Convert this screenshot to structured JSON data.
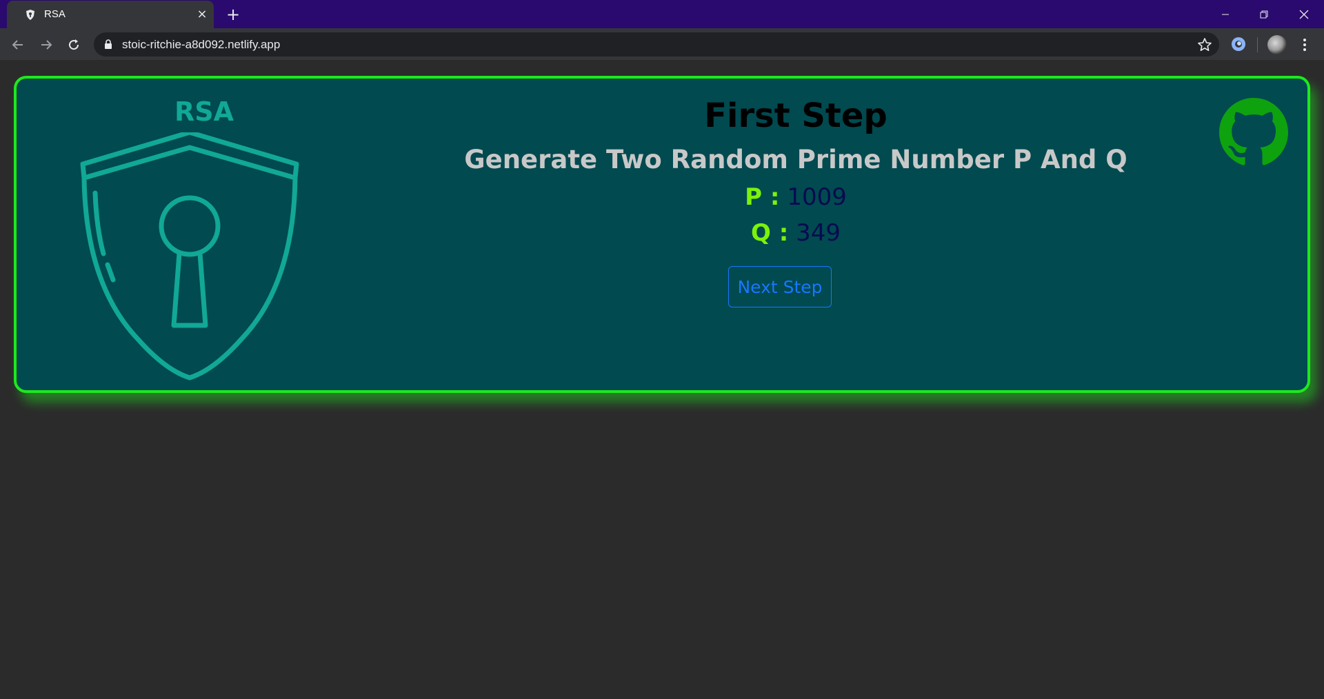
{
  "browser": {
    "tab_title": "RSA",
    "tab_close": "×",
    "new_tab": "+",
    "url": "stoic-ritchie-a8d092.netlify.app"
  },
  "page": {
    "logo_title": "RSA",
    "step_title": "First Step",
    "step_subtitle": "Generate Two Random Prime Number P And Q",
    "p_label": "P :",
    "p_value": "1009",
    "q_label": "Q :",
    "q_value": "349",
    "next_button": "Next Step"
  },
  "colors": {
    "card_bg": "#004a50",
    "card_border": "#1ee81e",
    "shield": "#11a896",
    "prime_label": "#7cf20a",
    "prime_value": "#0a0a50",
    "button": "#1877ff",
    "github": "#0fa20f",
    "titlebar": "#2a0a6e"
  },
  "icons": [
    "shield-lock-icon",
    "github-icon",
    "lock-icon",
    "star-icon",
    "back-icon",
    "forward-icon",
    "reload-icon"
  ]
}
